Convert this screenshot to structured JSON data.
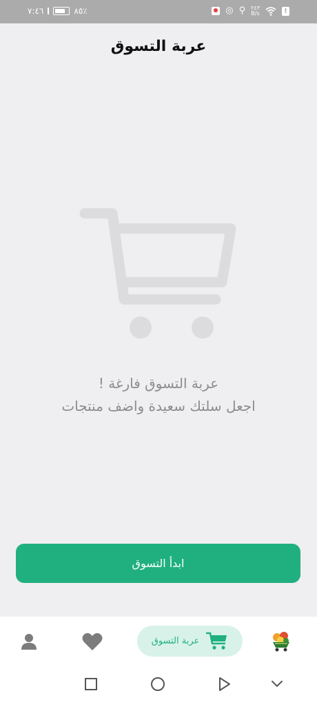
{
  "status_bar": {
    "time": "٧:٤٦",
    "battery": "٨٥٪",
    "net_speed": "٢٤٣",
    "net_unit": "B/s"
  },
  "header": {
    "title": "عربة التسوق"
  },
  "empty_state": {
    "title": "عربة التسوق فارغة !",
    "subtitle": "اجعل سلتك سعيدة واضف منتجات",
    "illustration": "shopping-cart-icon"
  },
  "actions": {
    "start_shopping": "ابدأ التسوق"
  },
  "bottom_nav": {
    "cart_label": "عربة التسوق",
    "items": [
      "profile-icon",
      "heart-icon",
      "cart-icon",
      "home-logo-icon"
    ]
  },
  "colors": {
    "accent": "#20b07f",
    "accent_light": "#d8f2ea",
    "background": "#efeef1",
    "muted_text": "#8c8c8e",
    "status_bar": "#ababab"
  }
}
